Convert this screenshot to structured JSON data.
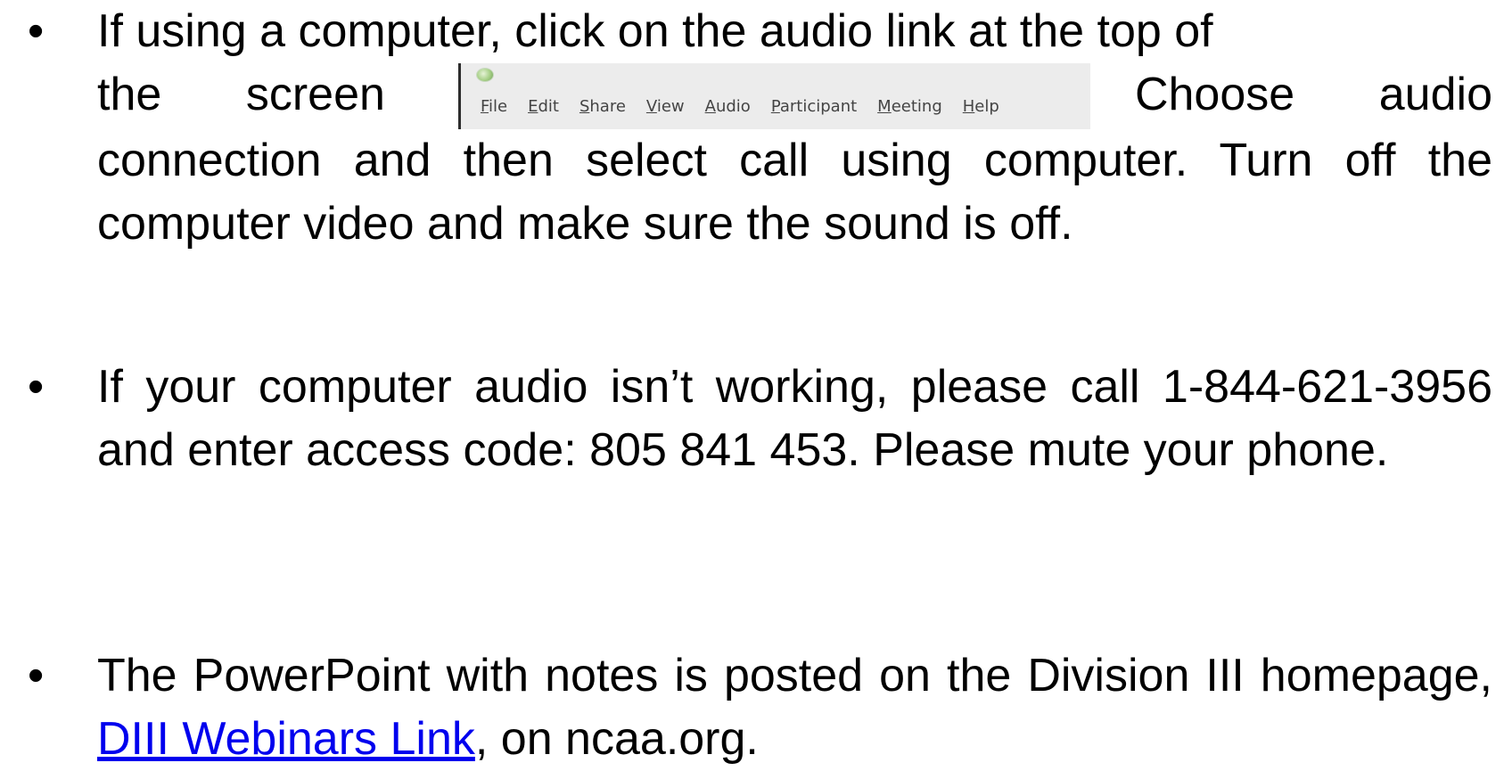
{
  "bullet_symbol": "•",
  "bullets": [
    {
      "line1": "If using a computer, click on the audio link at the top of",
      "line2_start": "the screen",
      "line2_end": "Choose audio",
      "rest": "connection and then select call using computer. Turn off the computer video and make sure the sound is off."
    },
    {
      "text": "If your computer audio isn’t working, please call 1-844-621-3956 and enter access code: 805 841 453. Please mute your phone."
    },
    {
      "text_before_link": "The PowerPoint with notes is posted on the Division III homepage, ",
      "link_text": "DIII Webinars Link",
      "text_after_link": ", on ncaa.org."
    }
  ],
  "menu_bar": {
    "logo_icon": "zoom-green-logo-icon",
    "items": [
      {
        "mnemonic": "F",
        "rest": "ile"
      },
      {
        "mnemonic": "E",
        "rest": "dit"
      },
      {
        "mnemonic": "S",
        "rest": "hare"
      },
      {
        "mnemonic": "V",
        "rest": "iew"
      },
      {
        "mnemonic": "A",
        "rest": "udio"
      },
      {
        "mnemonic": "P",
        "rest": "articipant"
      },
      {
        "mnemonic": "M",
        "rest": "eeting"
      },
      {
        "mnemonic": "H",
        "rest": "elp"
      }
    ]
  },
  "colors": {
    "text": "#000000",
    "link": "#0000ee",
    "menu_background": "#ececec",
    "menu_text": "#444444"
  }
}
